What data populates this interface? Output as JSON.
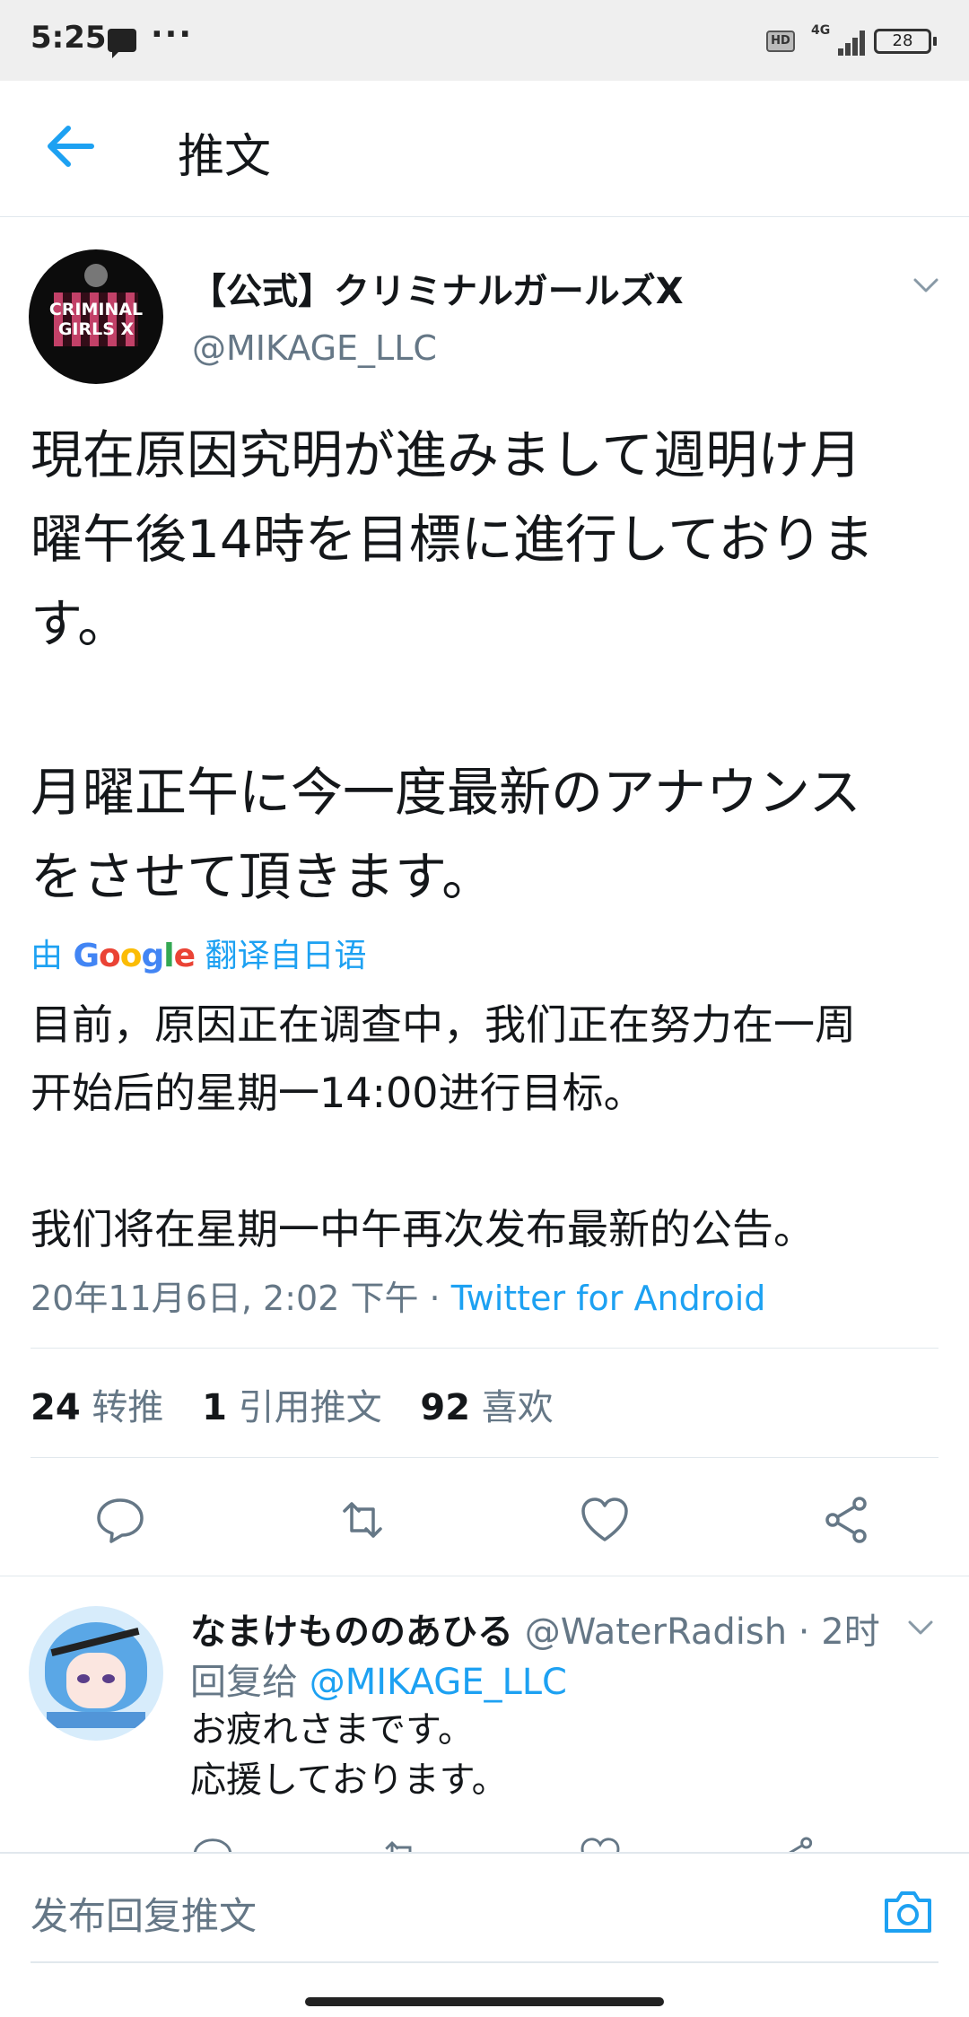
{
  "status_bar": {
    "time": "5:25",
    "hd": "HD",
    "network": "4G",
    "battery": "28",
    "message_icon": "message-icon",
    "more_icon": "more-dots-icon"
  },
  "header": {
    "title": "推文",
    "back_icon": "arrow-left-icon"
  },
  "tweet": {
    "author_name": "【公式】クリミナルガールズX",
    "author_handle": "@MIKAGE_LLC",
    "avatar_text": "CRIMINAL GIRLS X",
    "text": "現在原因究明が進みまして週明け月\n曜午後14時を目標に進行しておりま\nす。\n\n月曜正午に今一度最新のアナウンス\nをさせて頂きます。",
    "translated_prefix": "由",
    "translated_brand": "Google",
    "translated_suffix": "翻译自日语",
    "translation": "目前，原因正在调查中，我们正在努力在一周\n开始后的星期一14:00进行目标。\n\n我们将在星期一中午再次发布最新的公告。",
    "timestamp": "20年11月6日, 2:02 下午",
    "separator": " · ",
    "source": "Twitter for Android",
    "stats": {
      "retweets_count": "24",
      "retweets_label": "转推",
      "quotes_count": "1",
      "quotes_label": "引用推文",
      "likes_count": "92",
      "likes_label": "喜欢"
    },
    "actions": [
      "reply-icon",
      "retweet-icon",
      "like-icon",
      "share-icon"
    ]
  },
  "reply": {
    "name": "なまけもののあひる",
    "handle": "@WaterRadish",
    "time": " · 2时",
    "reply_to_label": "回复给",
    "reply_to_handle": "@MIKAGE_LLC",
    "text": "お疲れさまです。\n応援しております。"
  },
  "compose": {
    "placeholder": "发布回复推文",
    "camera_icon": "camera-icon"
  },
  "colors": {
    "accent": "#1da1f2",
    "secondary_text": "#657786",
    "primary_text": "#14171a",
    "divider": "#e1e8ed"
  }
}
